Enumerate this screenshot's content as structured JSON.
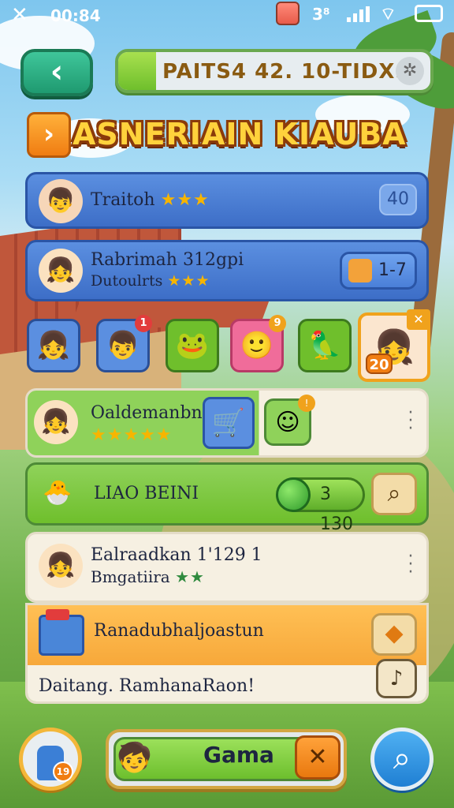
{
  "status_bar": {
    "close_glyph": "✕",
    "time": "00:84",
    "network": "3⁸",
    "icons": [
      "close-icon",
      "cup-icon",
      "signal-icon",
      "wifi-icon",
      "battery-icon"
    ]
  },
  "top_bar": {
    "back_glyph": "‹",
    "progress_text": "PAITS4 42. 10-TIDXS",
    "progress_fraction": 0.12,
    "settings_glyph": "✲"
  },
  "title": {
    "arrow_glyph": "›",
    "text": "ASNERIAIN KIAUBA"
  },
  "rows": [
    {
      "name": "Traitoh",
      "stars": "★★★",
      "badge": "40"
    },
    {
      "name": "Rabrimah 312gpi",
      "subtitle": "Dutoulrts",
      "stars": "★★★",
      "pill": "1-7"
    },
    {
      "name": "Oaldemanbn",
      "stars": "★★★★★"
    },
    {
      "name": "LIAO BEINI",
      "coins": "3 130"
    },
    {
      "name": "Ealraadkan 1'129 1",
      "subtitle": "Bmgatiira",
      "stars": "★★"
    }
  ],
  "tiles": [
    {
      "name": "avatar-girl",
      "glyph": "👧"
    },
    {
      "name": "avatar-boy",
      "glyph": "👦",
      "notify": "1"
    },
    {
      "name": "green-creature",
      "glyph": "🐸"
    },
    {
      "name": "pink-creature",
      "glyph": "🙂",
      "notify": "9"
    },
    {
      "name": "green-bird",
      "glyph": "🦜"
    }
  ],
  "featured_tile": {
    "glyph": "👧",
    "level": "20",
    "flag": "✕"
  },
  "panel": {
    "title": "Ranadubhaljoastun",
    "footer": "Daitang. RamhanaRaon!"
  },
  "bottom_bar": {
    "game_label": "Gama",
    "close_glyph": "✕",
    "level_badge": "19",
    "search_glyph": "⌕"
  },
  "colors": {
    "accent_green": "#6fbf2c",
    "accent_blue": "#3d6ec7",
    "accent_orange": "#f07d12",
    "title_yellow": "#ffd23c"
  }
}
